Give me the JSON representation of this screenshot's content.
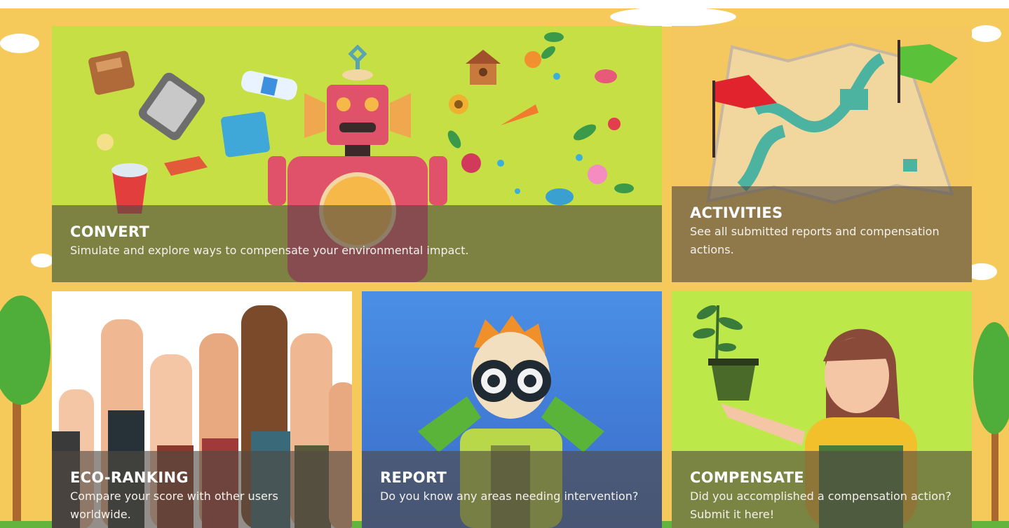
{
  "tiles": {
    "convert": {
      "title": "CONVERT",
      "description": "Simulate and explore ways to compensate your environmental impact."
    },
    "activities": {
      "title": "ACTIVITIES",
      "description": "See all submitted reports and compensation actions."
    },
    "eco_ranking": {
      "title": "ECO-RANKING",
      "description": "Compare your score with other users worldwide."
    },
    "report": {
      "title": "REPORT",
      "description": "Do you know any areas needing intervention?"
    },
    "compensate": {
      "title": "COMPENSATE",
      "description": "Did you accomplished a compensation action? Submit it here!"
    }
  },
  "colors": {
    "background": "#f5c95a",
    "convert_tile": "#c6df45",
    "activities_tile": "#f4c85e",
    "eco_tile": "#ffffff",
    "report_tile": "#4a8fe6",
    "compensate_tile": "#bde84a",
    "caption_overlay": "#504840"
  }
}
